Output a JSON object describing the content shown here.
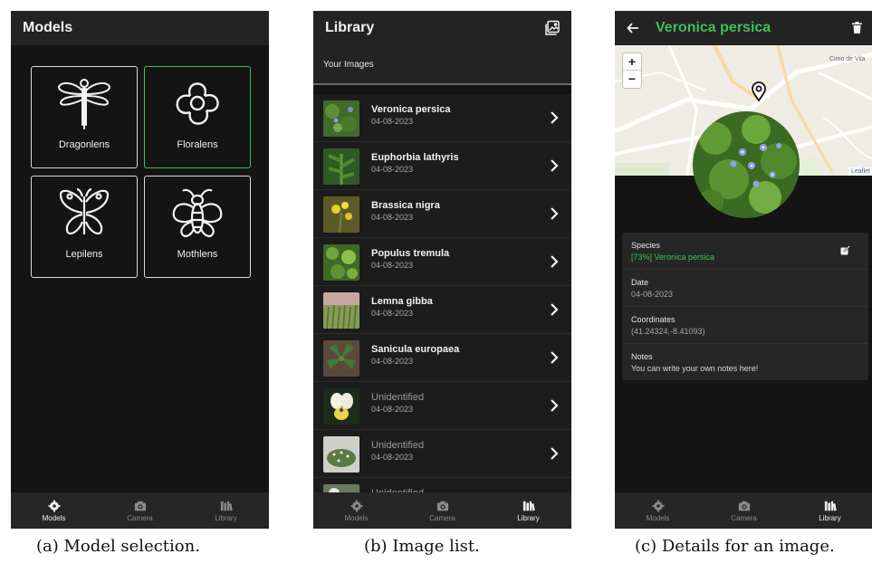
{
  "panel_a": {
    "title": "Models",
    "models": [
      {
        "label": "Dragonlens",
        "icon": "dragonfly-icon",
        "selected": false
      },
      {
        "label": "Floralens",
        "icon": "flower-icon",
        "selected": true
      },
      {
        "label": "Lepilens",
        "icon": "butterfly-icon",
        "selected": false
      },
      {
        "label": "Mothlens",
        "icon": "moth-icon",
        "selected": false
      }
    ],
    "active_tab": "Models"
  },
  "panel_b": {
    "title": "Library",
    "subheader": "Your Images",
    "items": [
      {
        "name": "Veronica persica",
        "date": "04-08-2023"
      },
      {
        "name": "Euphorbia lathyris",
        "date": "04-08-2023"
      },
      {
        "name": "Brassica nigra",
        "date": "04-08-2023"
      },
      {
        "name": "Populus tremula",
        "date": "04-08-2023"
      },
      {
        "name": "Lemna gibba",
        "date": "04-08-2023"
      },
      {
        "name": "Sanicula europaea",
        "date": "04-08-2023"
      },
      {
        "name": "Unidentified",
        "date": "04-08-2023"
      },
      {
        "name": "Unidentified",
        "date": "04-08-2023"
      },
      {
        "name": "Unidentified",
        "date": ""
      }
    ],
    "active_tab": "Library"
  },
  "panel_c": {
    "title": "Veronica persica",
    "map": {
      "zoom_in": "+",
      "zoom_out": "−",
      "place": "Cimo de Vila",
      "attribution": "Leaflet"
    },
    "details": {
      "species_label": "Species",
      "species_value": "[73%] Veronica persica",
      "date_label": "Date",
      "date_value": "04-08-2023",
      "coords_label": "Coordinates",
      "coords_value": "(41.24324,-8.41093)",
      "notes_label": "Notes",
      "notes_value": "You can write your own notes here!"
    },
    "active_tab": "Library"
  },
  "nav": {
    "models": "Models",
    "camera": "Camera",
    "library": "Library"
  },
  "captions": {
    "a": "(a) Model selection.",
    "b": "(b) Image list.",
    "c": "(c) Details for an image."
  },
  "colors": {
    "accent": "#3fbf5a",
    "background": "#141414",
    "appbar": "#232323"
  }
}
